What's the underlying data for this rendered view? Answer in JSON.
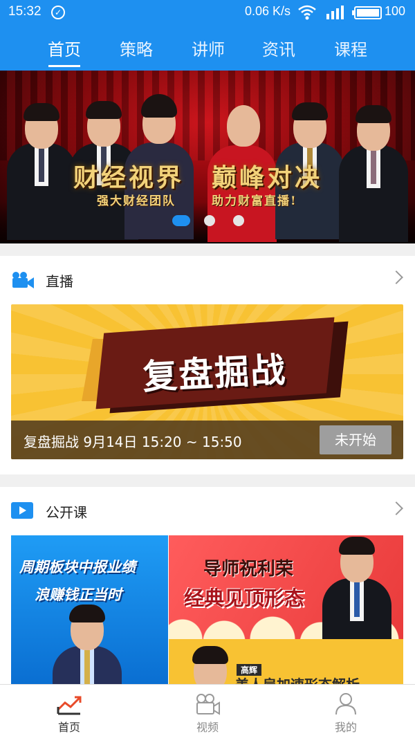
{
  "status_bar": {
    "time": "15:32",
    "net_speed": "0.06 K/s",
    "battery": "100",
    "icons": [
      "check-circle-icon",
      "wifi-icon",
      "signal-icon",
      "battery-icon"
    ]
  },
  "top_tabs": [
    {
      "label": "首页",
      "active": true
    },
    {
      "label": "策略",
      "active": false
    },
    {
      "label": "讲师",
      "active": false
    },
    {
      "label": "资讯",
      "active": false
    },
    {
      "label": "课程",
      "active": false
    }
  ],
  "banner": {
    "title_left": "财经视界",
    "title_right": "巅峰对决",
    "sub_left": "强大财经团队",
    "sub_right": "助力财富直播!",
    "carousel_active_index": 0,
    "carousel_count": 3
  },
  "live_section": {
    "title": "直播",
    "icon": "video-camera-icon",
    "image_title": "复盘掘战",
    "info": "复盘掘战  9月14日 15:20 ~ 15:50",
    "status_button": "未开始"
  },
  "course_section": {
    "title": "公开课",
    "icon": "play-icon",
    "left_line1": "周期板块中报业绩",
    "left_line2": "浪赚钱正当时",
    "right_top_line1": "导师祝利荣",
    "right_top_line2": "经典见顶形态",
    "right_bottom_tag": "高辉",
    "right_bottom_title": "美人肩加速形态解析"
  },
  "bottom_tabs": [
    {
      "label": "首页",
      "icon": "chart-home-icon",
      "active": true
    },
    {
      "label": "视频",
      "icon": "video-camera-icon",
      "active": false
    },
    {
      "label": "我的",
      "icon": "user-icon",
      "active": false
    }
  ],
  "colors": {
    "primary": "#1e90f0",
    "live_yellow": "#f8c233",
    "grey_button": "#9e9e9e"
  }
}
